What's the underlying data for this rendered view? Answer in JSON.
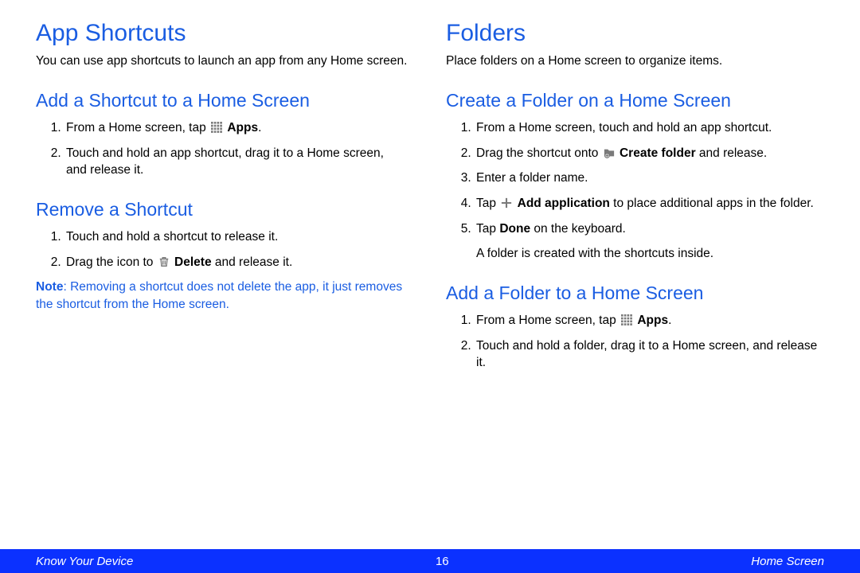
{
  "left": {
    "h1": "App Shortcuts",
    "intro": "You can use app shortcuts to launch an app from any Home screen.",
    "sec1": {
      "h2": "Add a Shortcut to a Home Screen",
      "li1_a": "From a Home screen, tap ",
      "li1_b": "Apps",
      "li1_c": ".",
      "li2": "Touch and hold an app shortcut, drag it to a Home screen, and release it."
    },
    "sec2": {
      "h2": "Remove a Shortcut",
      "li1": "Touch and hold a shortcut to release it.",
      "li2_a": "Drag the icon to ",
      "li2_b": "Delete",
      "li2_c": " and release it.",
      "note_label": "Note",
      "note_body": ": Removing a shortcut does not delete the app, it just removes the shortcut from the Home screen."
    }
  },
  "right": {
    "h1": "Folders",
    "intro": "Place folders on a Home screen to organize items.",
    "sec1": {
      "h2": "Create a Folder on a Home Screen",
      "li1": "From a Home screen, touch and hold an app shortcut.",
      "li2_a": "Drag the shortcut onto ",
      "li2_b": "Create folder",
      "li2_c": " and release.",
      "li3": "Enter a folder name.",
      "li4_a": "Tap ",
      "li4_b": "Add application",
      "li4_c": " to place additional apps in the folder.",
      "li5_a": "Tap ",
      "li5_b": "Done",
      "li5_c": " on the keyboard.",
      "li5_follow": "A folder is created with the shortcuts inside."
    },
    "sec2": {
      "h2": "Add a Folder to a Home Screen",
      "li1_a": "From a Home screen, tap ",
      "li1_b": "Apps",
      "li1_c": ".",
      "li2": "Touch and hold a folder, drag it to a Home screen, and release it."
    }
  },
  "footer": {
    "left": "Know Your Device",
    "page": "16",
    "right": "Home Screen"
  }
}
